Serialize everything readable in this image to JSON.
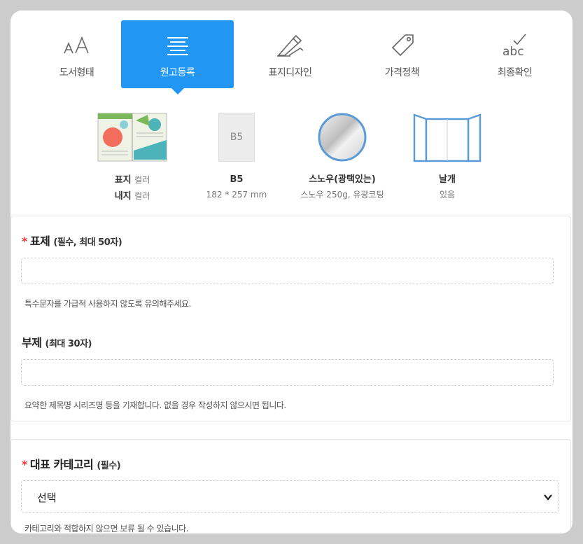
{
  "steps": [
    {
      "label": "도서형태",
      "icon": "font-size-icon",
      "active": false
    },
    {
      "label": "원고등록",
      "icon": "align-lines-icon",
      "active": true
    },
    {
      "label": "표지디자인",
      "icon": "brush-icon",
      "active": false
    },
    {
      "label": "가격정책",
      "icon": "price-tag-icon",
      "active": false
    },
    {
      "label": "최종확인",
      "icon": "abc-check-icon",
      "active": false
    }
  ],
  "summary": {
    "color": {
      "line1_label": "표지",
      "line1_value": "컬러",
      "line2_label": "내지",
      "line2_value": "컬러"
    },
    "size": {
      "thumb": "B5",
      "title": "B5",
      "detail": "182 * 257 mm"
    },
    "paper": {
      "title": "스노우(광택있는)",
      "detail": "스노우 250g, 유광코팅"
    },
    "flap": {
      "title": "날개",
      "detail": "있음"
    }
  },
  "form": {
    "title_field": {
      "required_mark": "*",
      "label": "표제",
      "note": "(필수, 최대 50자)",
      "value": "",
      "hint": "특수문자를 가급적 사용하지 않도록 유의해주세요."
    },
    "subtitle_field": {
      "label": "부제",
      "note": "(최대 30자)",
      "value": "",
      "hint": "요약한 제목명 시리즈명 등을 기재합니다. 없을 경우 작성하지 않으시면 됩니다."
    },
    "category_field": {
      "required_mark": "*",
      "label": "대표 카테고리",
      "note": "(필수)",
      "selected": "선택",
      "hint": "카테고리와 적합하지 않으면 보류 될 수 있습니다."
    }
  },
  "colors": {
    "accent": "#2196f3",
    "required": "#e53935",
    "paper_border": "#5b9bd5"
  }
}
